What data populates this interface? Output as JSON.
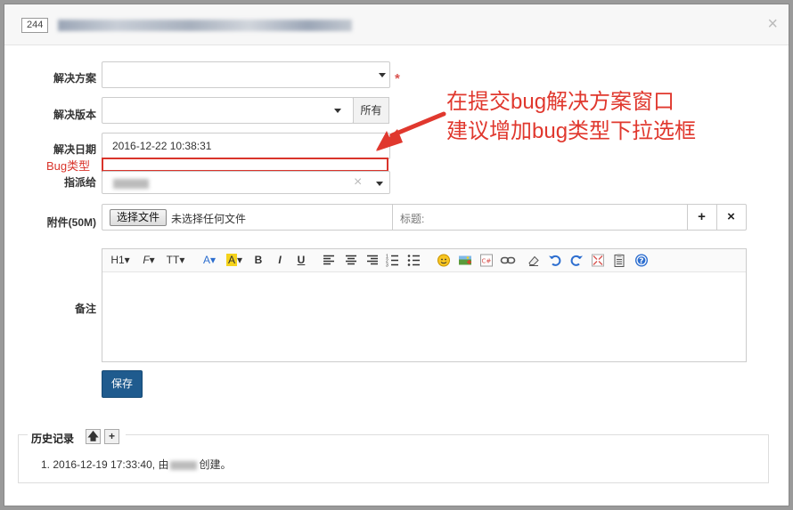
{
  "header": {
    "bug_id": "244",
    "close_glyph": "×"
  },
  "form": {
    "resolution": {
      "label": "解决方案",
      "value": "",
      "required_mark": "*"
    },
    "version": {
      "label": "解决版本",
      "value": "",
      "all_button": "所有"
    },
    "date": {
      "label": "解决日期",
      "value": "2016-12-22 10:38:31"
    },
    "bug_type": {
      "label": "Bug类型",
      "value": ""
    },
    "assign": {
      "label": "指派给",
      "clear_glyph": "×"
    },
    "attachment": {
      "label": "附件(50M)",
      "choose_button": "选择文件",
      "no_file_text": "未选择任何文件",
      "title_label": "标题:",
      "add_glyph": "+",
      "remove_glyph": "×"
    },
    "remark": {
      "label": "备注"
    },
    "save_button": "保存"
  },
  "toolbar": {
    "heading": "H1",
    "font_family": "F",
    "font_size": "TT",
    "font_color": "A",
    "highlight": "A",
    "bold": "B",
    "italic": "I",
    "underline": "U",
    "code": "C#"
  },
  "history": {
    "title": "历史记录",
    "up_glyph": "🡅",
    "add_glyph": "+",
    "entry_prefix": "1. 2016-12-19 17:33:40, 由",
    "entry_suffix": "创建。"
  },
  "annotation": {
    "line1": "在提交bug解决方案窗口",
    "line2": "建议增加bug类型下拉选框"
  },
  "colors": {
    "accent_red": "#d9342b",
    "save_blue": "#1f5b8e"
  }
}
